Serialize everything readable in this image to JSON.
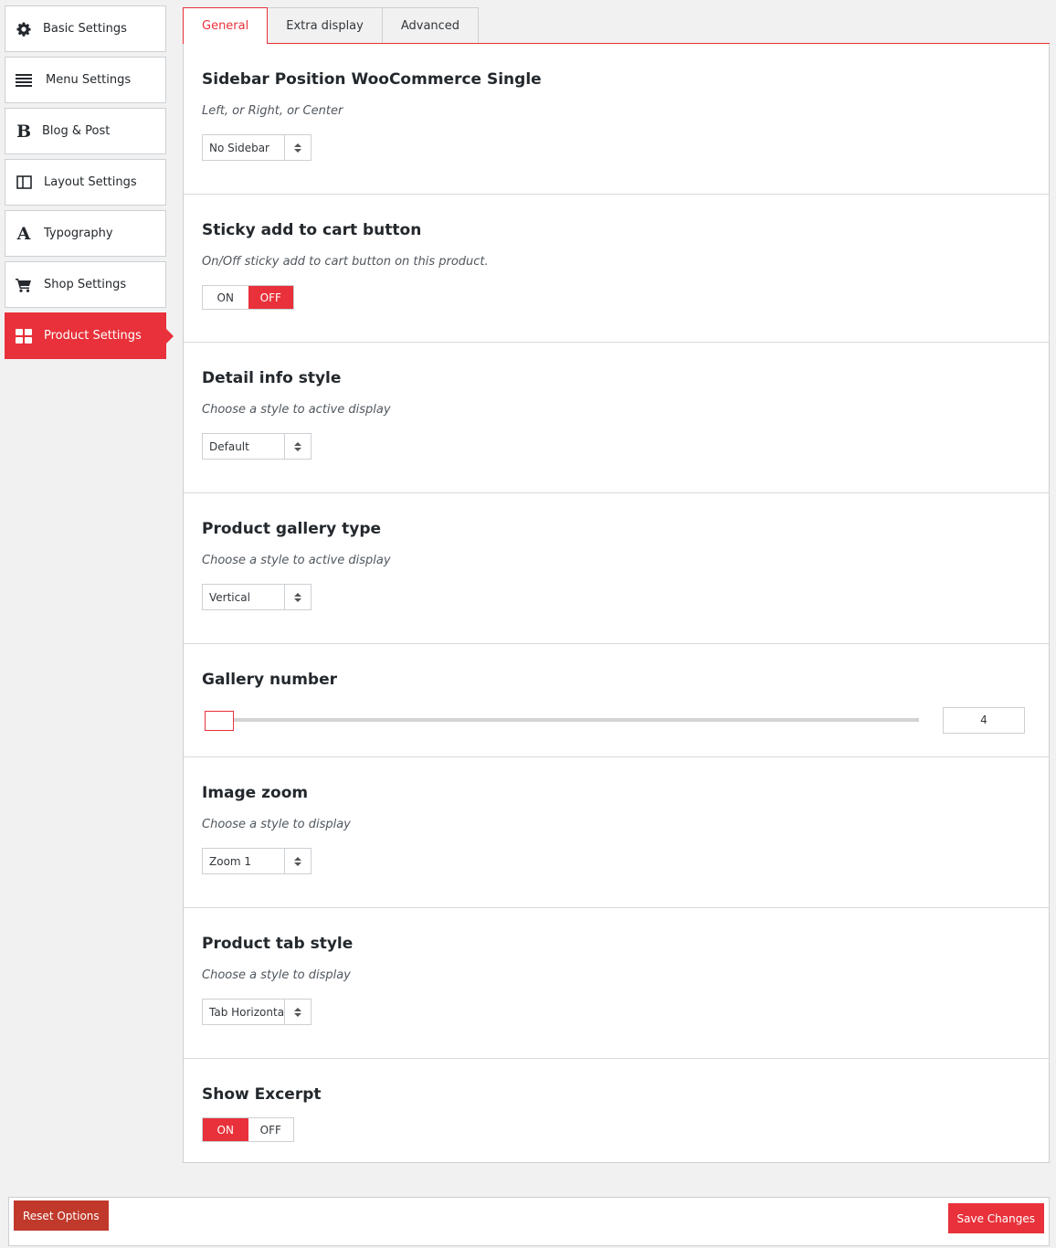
{
  "sidebar": {
    "items": [
      {
        "label": "Basic Settings",
        "icon": "gear-icon"
      },
      {
        "label": "Menu Settings",
        "icon": "menu-lines-icon"
      },
      {
        "label": "Blog & Post",
        "icon": "bold-b-icon",
        "glyph": "B"
      },
      {
        "label": "Layout Settings",
        "icon": "layout-columns-icon"
      },
      {
        "label": "Typography",
        "icon": "typography-a-icon",
        "glyph": "A"
      },
      {
        "label": "Shop Settings",
        "icon": "cart-icon"
      },
      {
        "label": "Product Settings",
        "icon": "grid-icon"
      }
    ],
    "active_index": 6
  },
  "tabs": [
    {
      "label": "General"
    },
    {
      "label": "Extra display"
    },
    {
      "label": "Advanced"
    }
  ],
  "sections": {
    "sidebar_position": {
      "title": "Sidebar Position WooCommerce Single",
      "desc": "Left, or Right, or Center",
      "value": "No Sidebar"
    },
    "sticky_cart": {
      "title": "Sticky add to cart button",
      "desc": "On/Off sticky add to cart button on this product.",
      "on_label": "ON",
      "off_label": "OFF",
      "state": "off"
    },
    "detail_info": {
      "title": "Detail info style",
      "desc": "Choose a style to active display",
      "value": "Default"
    },
    "gallery_type": {
      "title": "Product gallery type",
      "desc": "Choose a style to active display",
      "value": "Vertical"
    },
    "gallery_number": {
      "title": "Gallery number",
      "value": "4"
    },
    "image_zoom": {
      "title": "Image zoom",
      "desc": "Choose a style to display",
      "value": "Zoom 1"
    },
    "tab_style": {
      "title": "Product tab style",
      "desc": "Choose a style to display",
      "value": "Tab Horizontal"
    },
    "show_excerpt": {
      "title": "Show Excerpt",
      "on_label": "ON",
      "off_label": "OFF",
      "state": "on"
    }
  },
  "footer": {
    "reset_label": "Reset Options",
    "save_label": "Save Changes"
  },
  "colors": {
    "accent": "#e8313a",
    "reset_button": "#c0392b"
  }
}
